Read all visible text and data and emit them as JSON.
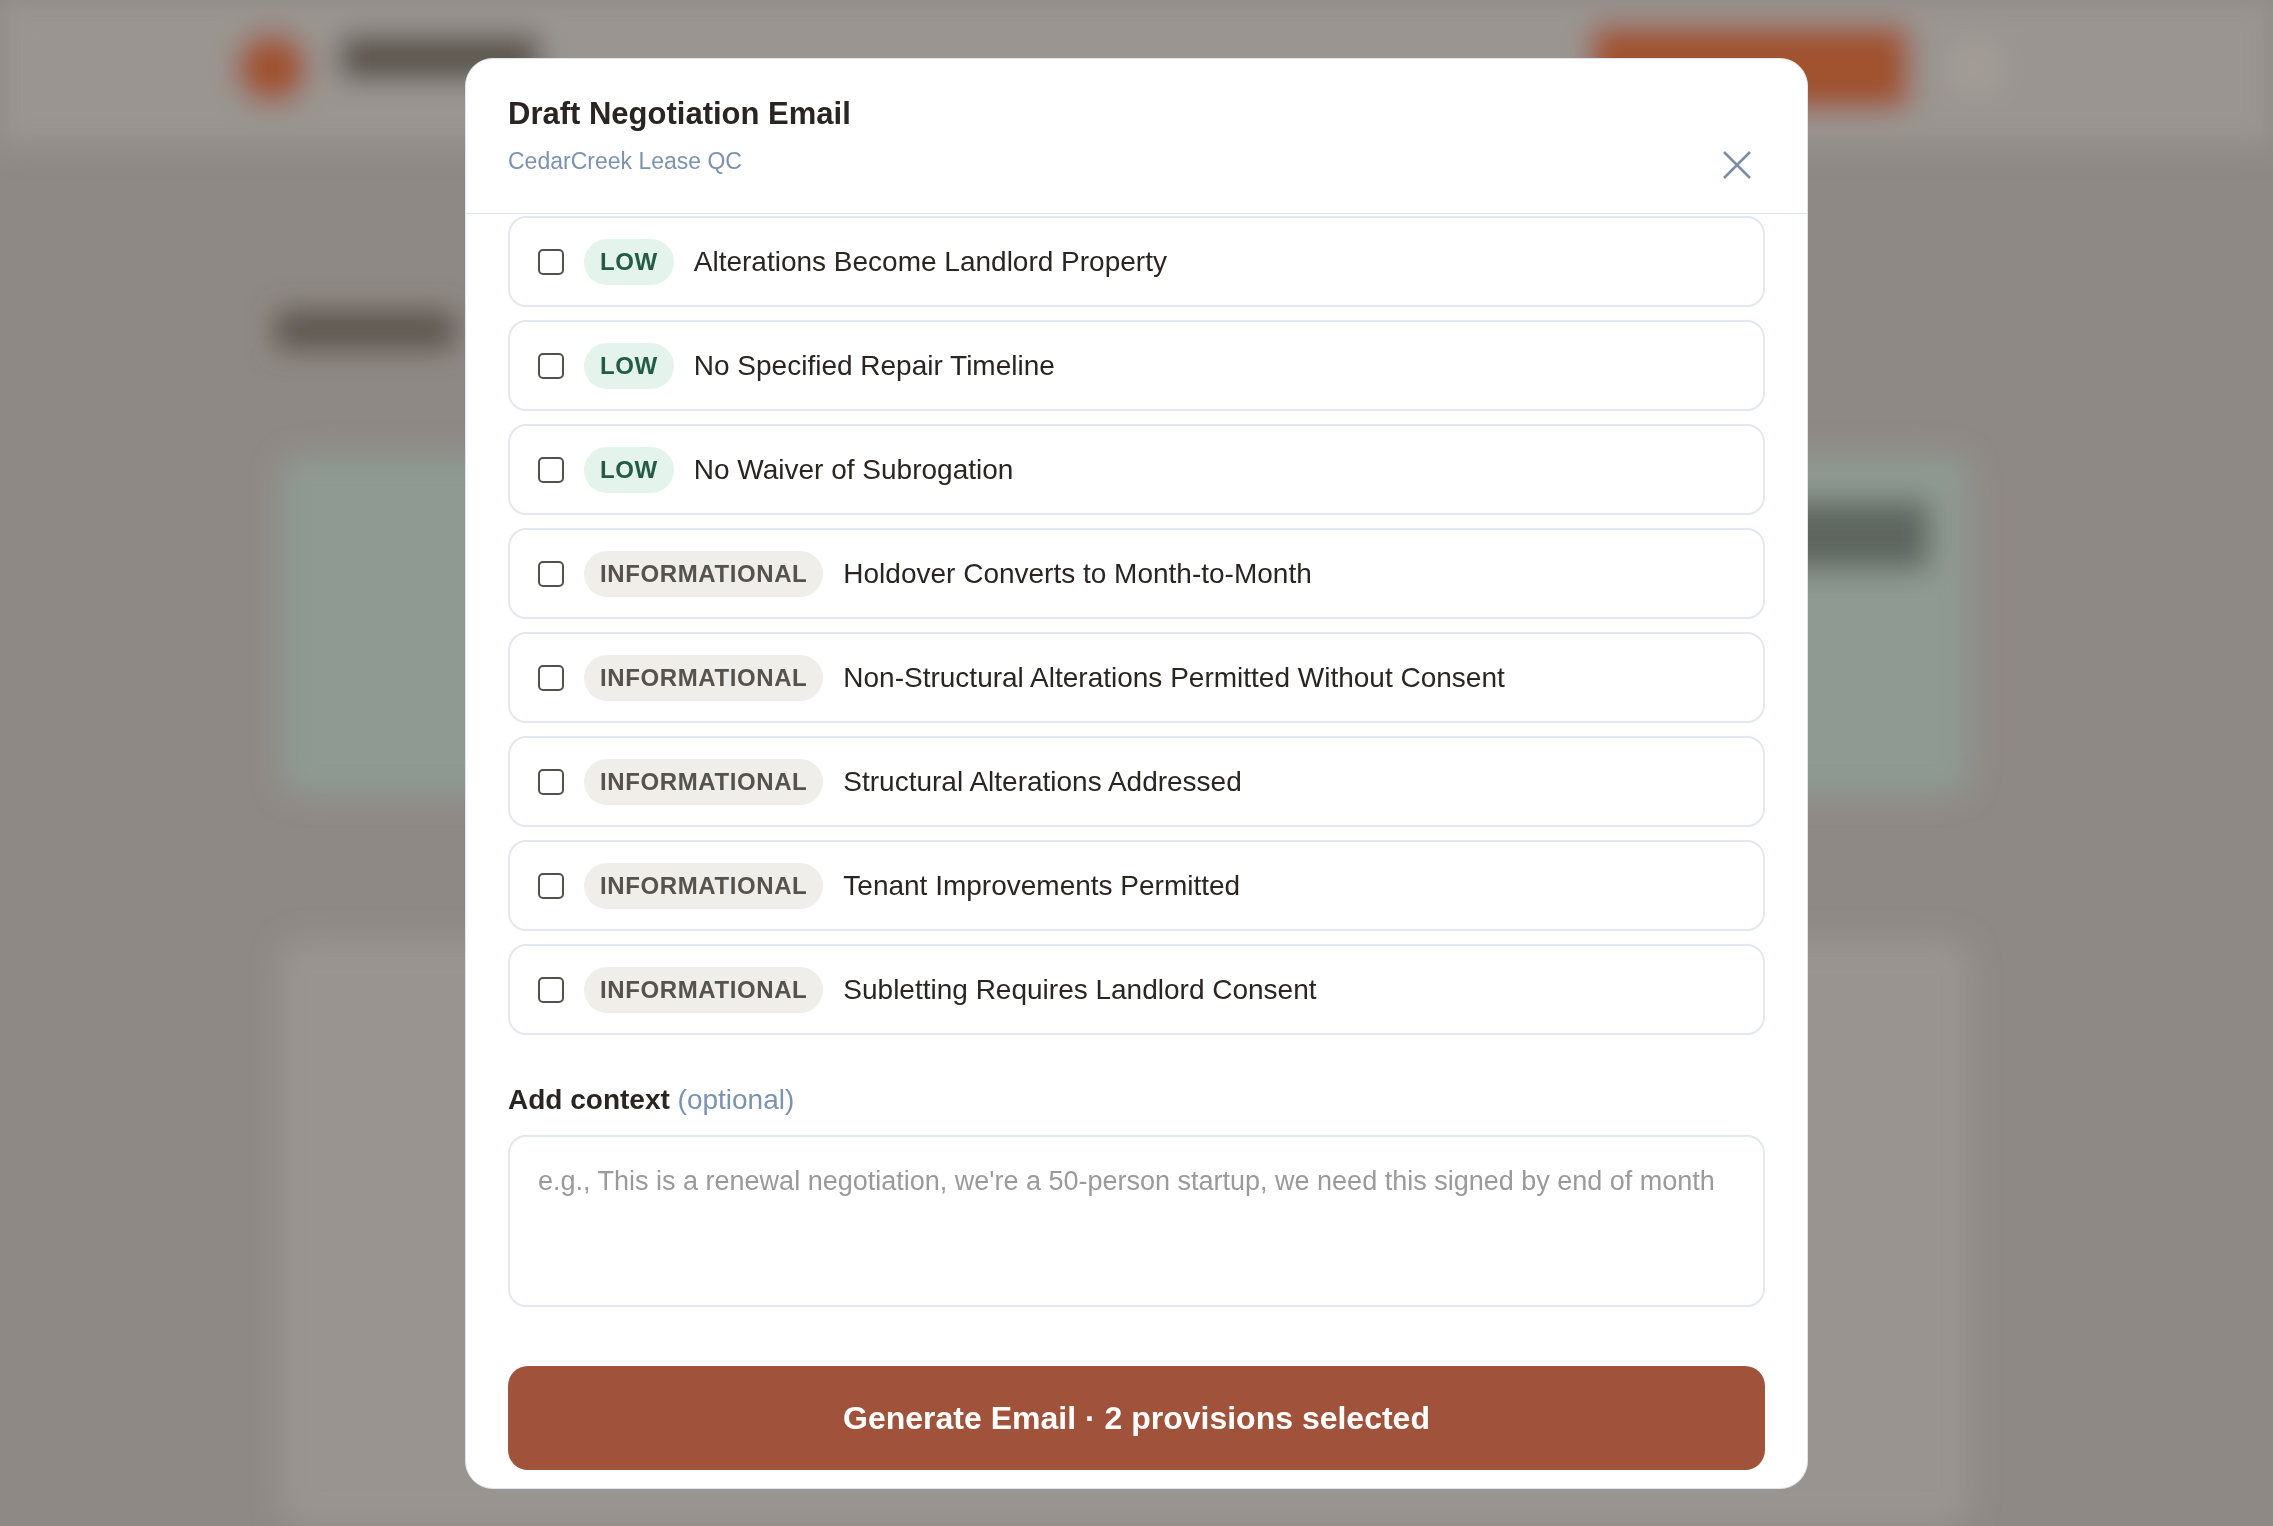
{
  "dialog": {
    "title": "Draft Negotiation Email",
    "subtitle": "CedarCreek Lease QC"
  },
  "provisions": [
    {
      "severity": "LOW",
      "kind": "low",
      "title": "Alterations Become Landlord Property",
      "checked": false
    },
    {
      "severity": "LOW",
      "kind": "low",
      "title": "No Specified Repair Timeline",
      "checked": false
    },
    {
      "severity": "LOW",
      "kind": "low",
      "title": "No Waiver of Subrogation",
      "checked": false
    },
    {
      "severity": "INFORMATIONAL",
      "kind": "info",
      "title": "Holdover Converts to Month-to-Month",
      "checked": false
    },
    {
      "severity": "INFORMATIONAL",
      "kind": "info",
      "title": "Non-Structural Alterations Permitted Without Consent",
      "checked": false
    },
    {
      "severity": "INFORMATIONAL",
      "kind": "info",
      "title": "Structural Alterations Addressed",
      "checked": false
    },
    {
      "severity": "INFORMATIONAL",
      "kind": "info",
      "title": "Tenant Improvements Permitted",
      "checked": false
    },
    {
      "severity": "INFORMATIONAL",
      "kind": "info",
      "title": "Subletting Requires Landlord Consent",
      "checked": false
    }
  ],
  "context": {
    "label": "Add context",
    "hint": "(optional)",
    "placeholder": "e.g., This is a renewal negotiation, we're a 50-person startup, we need this signed by end of month"
  },
  "generate_button": "Generate Email · 2 provisions selected"
}
